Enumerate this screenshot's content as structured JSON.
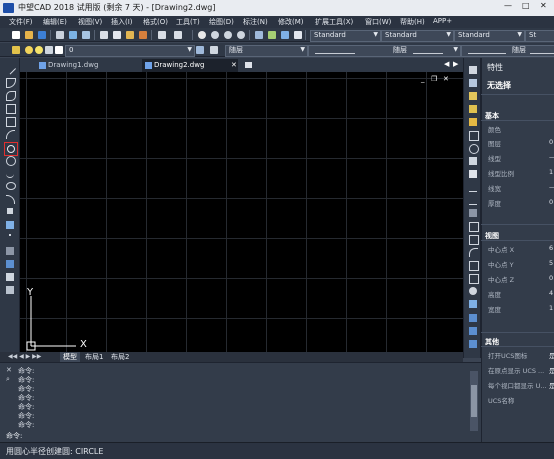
{
  "window": {
    "title": "中望CAD 2018 试用版 (剩余 7 天) - [Drawing2.dwg]",
    "controls": [
      "—",
      "□",
      "✕"
    ]
  },
  "menu": [
    "文件(F)",
    "编辑(E)",
    "视图(V)",
    "插入(I)",
    "格式(O)",
    "工具(T)",
    "绘图(D)",
    "标注(N)",
    "修改(M)",
    "扩展工具(X)",
    "窗口(W)",
    "帮助(H)",
    "APP+"
  ],
  "toolbar": {
    "text_style": "Standard",
    "dim_style": "Standard",
    "table_style": "Standard",
    "multileader_style": "St",
    "layer": "0",
    "color": "随层",
    "linetype": "随层",
    "lineweight": "随层"
  },
  "tabs": {
    "doc1": "Drawing1.dwg",
    "doc2": "Drawing2.dwg",
    "close": "✕"
  },
  "canvas": {
    "axis_x": "X",
    "axis_y": "Y",
    "win_controls": [
      "_",
      "❐",
      "✕"
    ]
  },
  "layout_tabs": [
    "模型",
    "布局1",
    "布局2"
  ],
  "properties": {
    "title": "特性",
    "selection": "无选择",
    "sections": {
      "basic": {
        "label": "基本",
        "rows": [
          {
            "name": "颜色",
            "value": ""
          },
          {
            "name": "图层",
            "value": "0"
          },
          {
            "name": "线型",
            "value": "—"
          },
          {
            "name": "线型比例",
            "value": "1"
          },
          {
            "name": "线宽",
            "value": "—"
          },
          {
            "name": "厚度",
            "value": "0"
          }
        ]
      },
      "view": {
        "label": "视图",
        "rows": [
          {
            "name": "中心点 X",
            "value": "6"
          },
          {
            "name": "中心点 Y",
            "value": "5"
          },
          {
            "name": "中心点 Z",
            "value": "0"
          },
          {
            "name": "高度",
            "value": "4"
          },
          {
            "name": "宽度",
            "value": "1"
          }
        ]
      },
      "misc": {
        "label": "其他",
        "rows": [
          {
            "name": "打开UCS图标",
            "value": "是"
          },
          {
            "name": "在原点显示 UCS ...",
            "value": "是"
          },
          {
            "name": "每个视口都显示 U...",
            "value": "是"
          },
          {
            "name": "UCS名称",
            "value": ""
          }
        ]
      }
    }
  },
  "command": {
    "lines": [
      "命令:",
      "命令:",
      "命令:",
      "命令:",
      "命令:",
      "命令:",
      "命令:"
    ],
    "input_label": "命令:"
  },
  "status": {
    "text": "用圆心半径创建圆: CIRCLE"
  },
  "colors": {
    "canvas_bg": "#000000",
    "active_tool_border": "#e03030",
    "panel_bg": "#333c4a"
  }
}
